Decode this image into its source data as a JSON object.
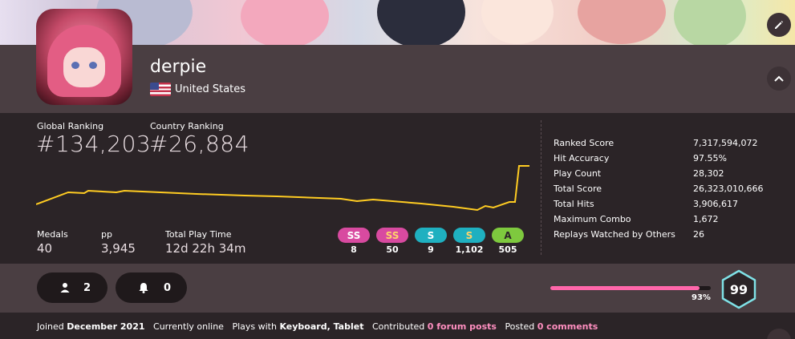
{
  "profile": {
    "username": "derpie",
    "country": "United States"
  },
  "ranking": {
    "global_label": "Global Ranking",
    "global_value": "#134,203",
    "country_label": "Country Ranking",
    "country_value": "#26,884"
  },
  "summary": {
    "medals_label": "Medals",
    "medals_value": "40",
    "pp_label": "pp",
    "pp_value": "3,945",
    "playtime_label": "Total Play Time",
    "playtime_value": "12d 22h 34m"
  },
  "grades": [
    {
      "label": "SS",
      "count": "8",
      "color": "#d84aa0",
      "text": "#ffffff"
    },
    {
      "label": "SS",
      "count": "50",
      "color": "#d84aa0",
      "text": "#ffd36b"
    },
    {
      "label": "S",
      "count": "9",
      "color": "#1fb0c0",
      "text": "#ffffff"
    },
    {
      "label": "S",
      "count": "1,102",
      "color": "#1fb0c0",
      "text": "#ffd36b"
    },
    {
      "label": "A",
      "count": "505",
      "color": "#7ec93e",
      "text": "#2b2427"
    }
  ],
  "stats": [
    {
      "label": "Ranked Score",
      "value": "7,317,594,072"
    },
    {
      "label": "Hit Accuracy",
      "value": "97.55%"
    },
    {
      "label": "Play Count",
      "value": "28,302"
    },
    {
      "label": "Total Score",
      "value": "26,323,010,666"
    },
    {
      "label": "Total Hits",
      "value": "3,906,617"
    },
    {
      "label": "Maximum Combo",
      "value": "1,672"
    },
    {
      "label": "Replays Watched by Others",
      "value": "26"
    }
  ],
  "social": {
    "followers": "2",
    "notifications": "0"
  },
  "level": {
    "value": "99",
    "progress_label": "93%",
    "progress": 0.93
  },
  "info": {
    "joined_prefix": "Joined",
    "joined_value": "December 2021",
    "status": "Currently online",
    "plays_prefix": "Plays with",
    "plays_value": "Keyboard, Tablet",
    "contrib_prefix": "Contributed",
    "contrib_value": "0 forum posts",
    "posted_prefix": "Posted",
    "posted_value": "0 comments"
  },
  "colors": {
    "graph_line": "#ffcc22",
    "accent_pink": "#ff66aa",
    "level_ring": "#7fe1e6"
  },
  "icons": [
    "pencil-icon",
    "chevron-up-icon",
    "user-icon",
    "bell-icon",
    "us-flag-icon"
  ]
}
